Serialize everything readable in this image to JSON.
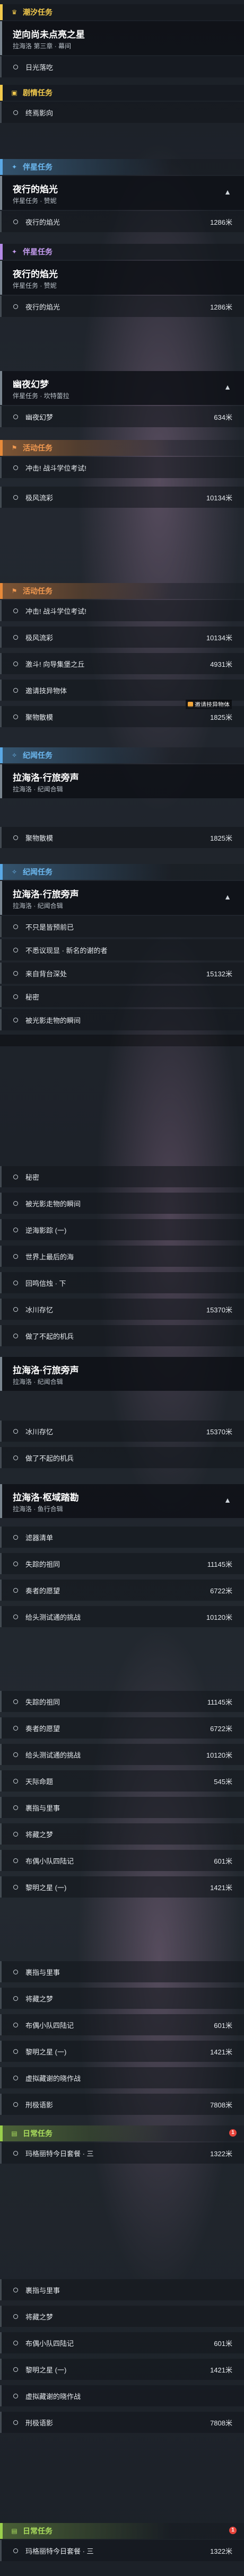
{
  "labels": {
    "daily_seal": "潮汐任务",
    "story": "剧情任务",
    "star": "伴星任务",
    "activity": "活动任务",
    "legend": "纪闻任务",
    "daily": "日常任务"
  },
  "quests": {
    "q1": {
      "title": "逆向尚未点亮之星",
      "sub": "拉海洛 第三章 · 幕间"
    },
    "q2": {
      "title": "夜行的焰光",
      "sub": "伴星任务 · 赞妮"
    },
    "q3": {
      "title": "幽夜幻梦",
      "sub": "伴星任务 · 坎特蕾拉"
    },
    "q4": {
      "title": "拉海洛·行旅旁声",
      "sub": "拉海洛 · 纪闻合辑"
    },
    "q5": {
      "title": "拉海洛·枢域踏勘",
      "sub": "拉海洛 · 鱼行合辑"
    }
  },
  "tasks": {
    "t01": {
      "label": "日光落吃"
    },
    "t02": {
      "label": "终焉影向"
    },
    "t03": {
      "label": "夜行的焰光",
      "dist": "1286米"
    },
    "t04": {
      "label": "幽夜幻梦",
      "dist": "634米"
    },
    "t05": {
      "label": "冲击! 战斗学位考试!"
    },
    "t06": {
      "label": "极风流彩",
      "dist": "10134米"
    },
    "t07": {
      "label": "激斗! 向导集堡之丘",
      "dist": "4931米"
    },
    "t08": {
      "label": "邀请技异物体"
    },
    "t09": {
      "label": "聚物散模",
      "dist": "1825米"
    },
    "t10": {
      "label": "不只是皆预前已"
    },
    "t11": {
      "label": "不悉议现显 · 新名的谢的者"
    },
    "t12": {
      "label": "来自背台深处",
      "dist": "15132米"
    },
    "t13": {
      "label": "秘密"
    },
    "t14": {
      "label": "被光影走物的瞬间"
    },
    "t15": {
      "label": "逆海影踪 (一)"
    },
    "t16": {
      "label": "世界上最后的海"
    },
    "t17": {
      "label": "回鸣信烛 · 下"
    },
    "t18": {
      "label": "冰川存忆",
      "dist": "15370米"
    },
    "t19": {
      "label": "做了不起的机兵"
    },
    "t20": {
      "label": "滤器清单"
    },
    "t21": {
      "label": "失踪的祖同",
      "dist": "11145米"
    },
    "t22": {
      "label": "奏者的愿望",
      "dist": "6722米"
    },
    "t23": {
      "label": "给头测试通的挑战",
      "dist": "10120米"
    },
    "t24": {
      "label": "天际命题",
      "dist": "545米"
    },
    "t25": {
      "label": "裹指与里事"
    },
    "t26": {
      "label": "将藏之梦"
    },
    "t27": {
      "label": "布偶小队四陆记",
      "dist": "601米"
    },
    "t28": {
      "label": "黎明之星 (一)",
      "dist": "1421米"
    },
    "t29": {
      "label": "虚拟藏谢的晓作战"
    },
    "t30": {
      "label": "刑极语影",
      "dist": "7808米"
    },
    "t31": {
      "label": "玛格丽特今日套餐 · 三",
      "dist": "1322米"
    }
  },
  "tooltip": {
    "text": "邀请技异物体"
  },
  "badge": {
    "count": "1"
  },
  "colors": {
    "yellow": "#f2c94c",
    "orange": "#e88a3a",
    "blue": "#5aa9e6",
    "purple": "#b48ae6",
    "green": "#9ad04c"
  }
}
